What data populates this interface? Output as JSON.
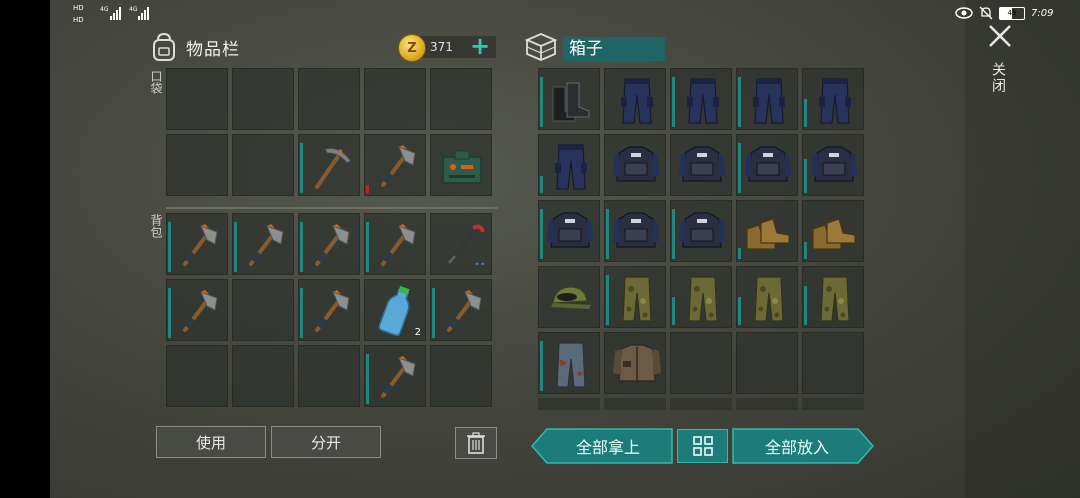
{
  "status_bar": {
    "left_text": "HD 4G 4G",
    "time": "7:09",
    "battery": "49"
  },
  "inventory": {
    "title": "物品栏",
    "coin_count": "371",
    "pocket_label": "口袋",
    "backpack_label": "背包",
    "pockets": [
      {
        "item": "empty"
      },
      {
        "item": "empty"
      },
      {
        "item": "empty"
      },
      {
        "item": "empty"
      },
      {
        "item": "empty"
      },
      {
        "item": "empty"
      },
      {
        "item": "empty"
      },
      {
        "item": "pickaxe-icon",
        "durability": 0.9
      },
      {
        "item": "hatchet-icon",
        "durability": 0.15,
        "durability_state": "low"
      },
      {
        "item": "explosive-box-icon"
      }
    ],
    "backpack": [
      {
        "item": "hatchet-icon",
        "durability": 0.9
      },
      {
        "item": "hatchet-icon",
        "durability": 0.9
      },
      {
        "item": "hatchet-icon",
        "durability": 0.9
      },
      {
        "item": "hatchet-icon",
        "durability": 0.9
      },
      {
        "item": "crowbar-icon",
        "dots": "••"
      },
      {
        "item": "hatchet-icon",
        "durability": 0.9
      },
      {
        "item": "empty"
      },
      {
        "item": "hatchet-icon",
        "durability": 0.9
      },
      {
        "item": "water-bottle-icon",
        "count": "2"
      },
      {
        "item": "hatchet-icon",
        "durability": 0.9
      },
      {
        "item": "empty"
      },
      {
        "item": "empty"
      },
      {
        "item": "empty"
      },
      {
        "item": "hatchet-icon",
        "durability": 0.9
      },
      {
        "item": "empty"
      }
    ],
    "use_button": "使用",
    "split_button": "分开"
  },
  "chest": {
    "title": "箱子",
    "items": [
      {
        "item": "boots-icon",
        "durability": 0.9
      },
      {
        "item": "police-pants-icon"
      },
      {
        "item": "police-pants-icon",
        "durability": 0.9
      },
      {
        "item": "police-pants-icon",
        "durability": 0.9
      },
      {
        "item": "police-pants-icon",
        "durability": 0.5
      },
      {
        "item": "police-pants-icon",
        "durability": 0.3
      },
      {
        "item": "police-vest-icon"
      },
      {
        "item": "police-vest-icon"
      },
      {
        "item": "police-vest-icon",
        "durability": 0.9
      },
      {
        "item": "police-vest-icon",
        "durability": 0.6
      },
      {
        "item": "police-vest-icon",
        "durability": 0.9
      },
      {
        "item": "police-vest-icon",
        "durability": 0.9
      },
      {
        "item": "police-vest-icon",
        "durability": 0.9
      },
      {
        "item": "work-boots-icon",
        "durability": 0.2
      },
      {
        "item": "work-boots-icon",
        "durability": 0.3
      },
      {
        "item": "camo-cap-icon"
      },
      {
        "item": "camo-pants-icon",
        "durability": 0.9
      },
      {
        "item": "camo-pants-icon",
        "durability": 0.5
      },
      {
        "item": "camo-pants-icon",
        "durability": 0.5
      },
      {
        "item": "camo-pants-icon",
        "durability": 0.7
      },
      {
        "item": "ripped-pants-icon",
        "durability": 0.9
      },
      {
        "item": "leather-jacket-icon"
      },
      {
        "item": "empty"
      },
      {
        "item": "empty"
      },
      {
        "item": "empty"
      }
    ],
    "take_all_button": "全部拿上",
    "put_all_button": "全部放入"
  },
  "close_label": "关闭",
  "colors": {
    "accent": "#1d7c79",
    "durability_bar": "#238580",
    "durability_low": "#b3262c"
  }
}
